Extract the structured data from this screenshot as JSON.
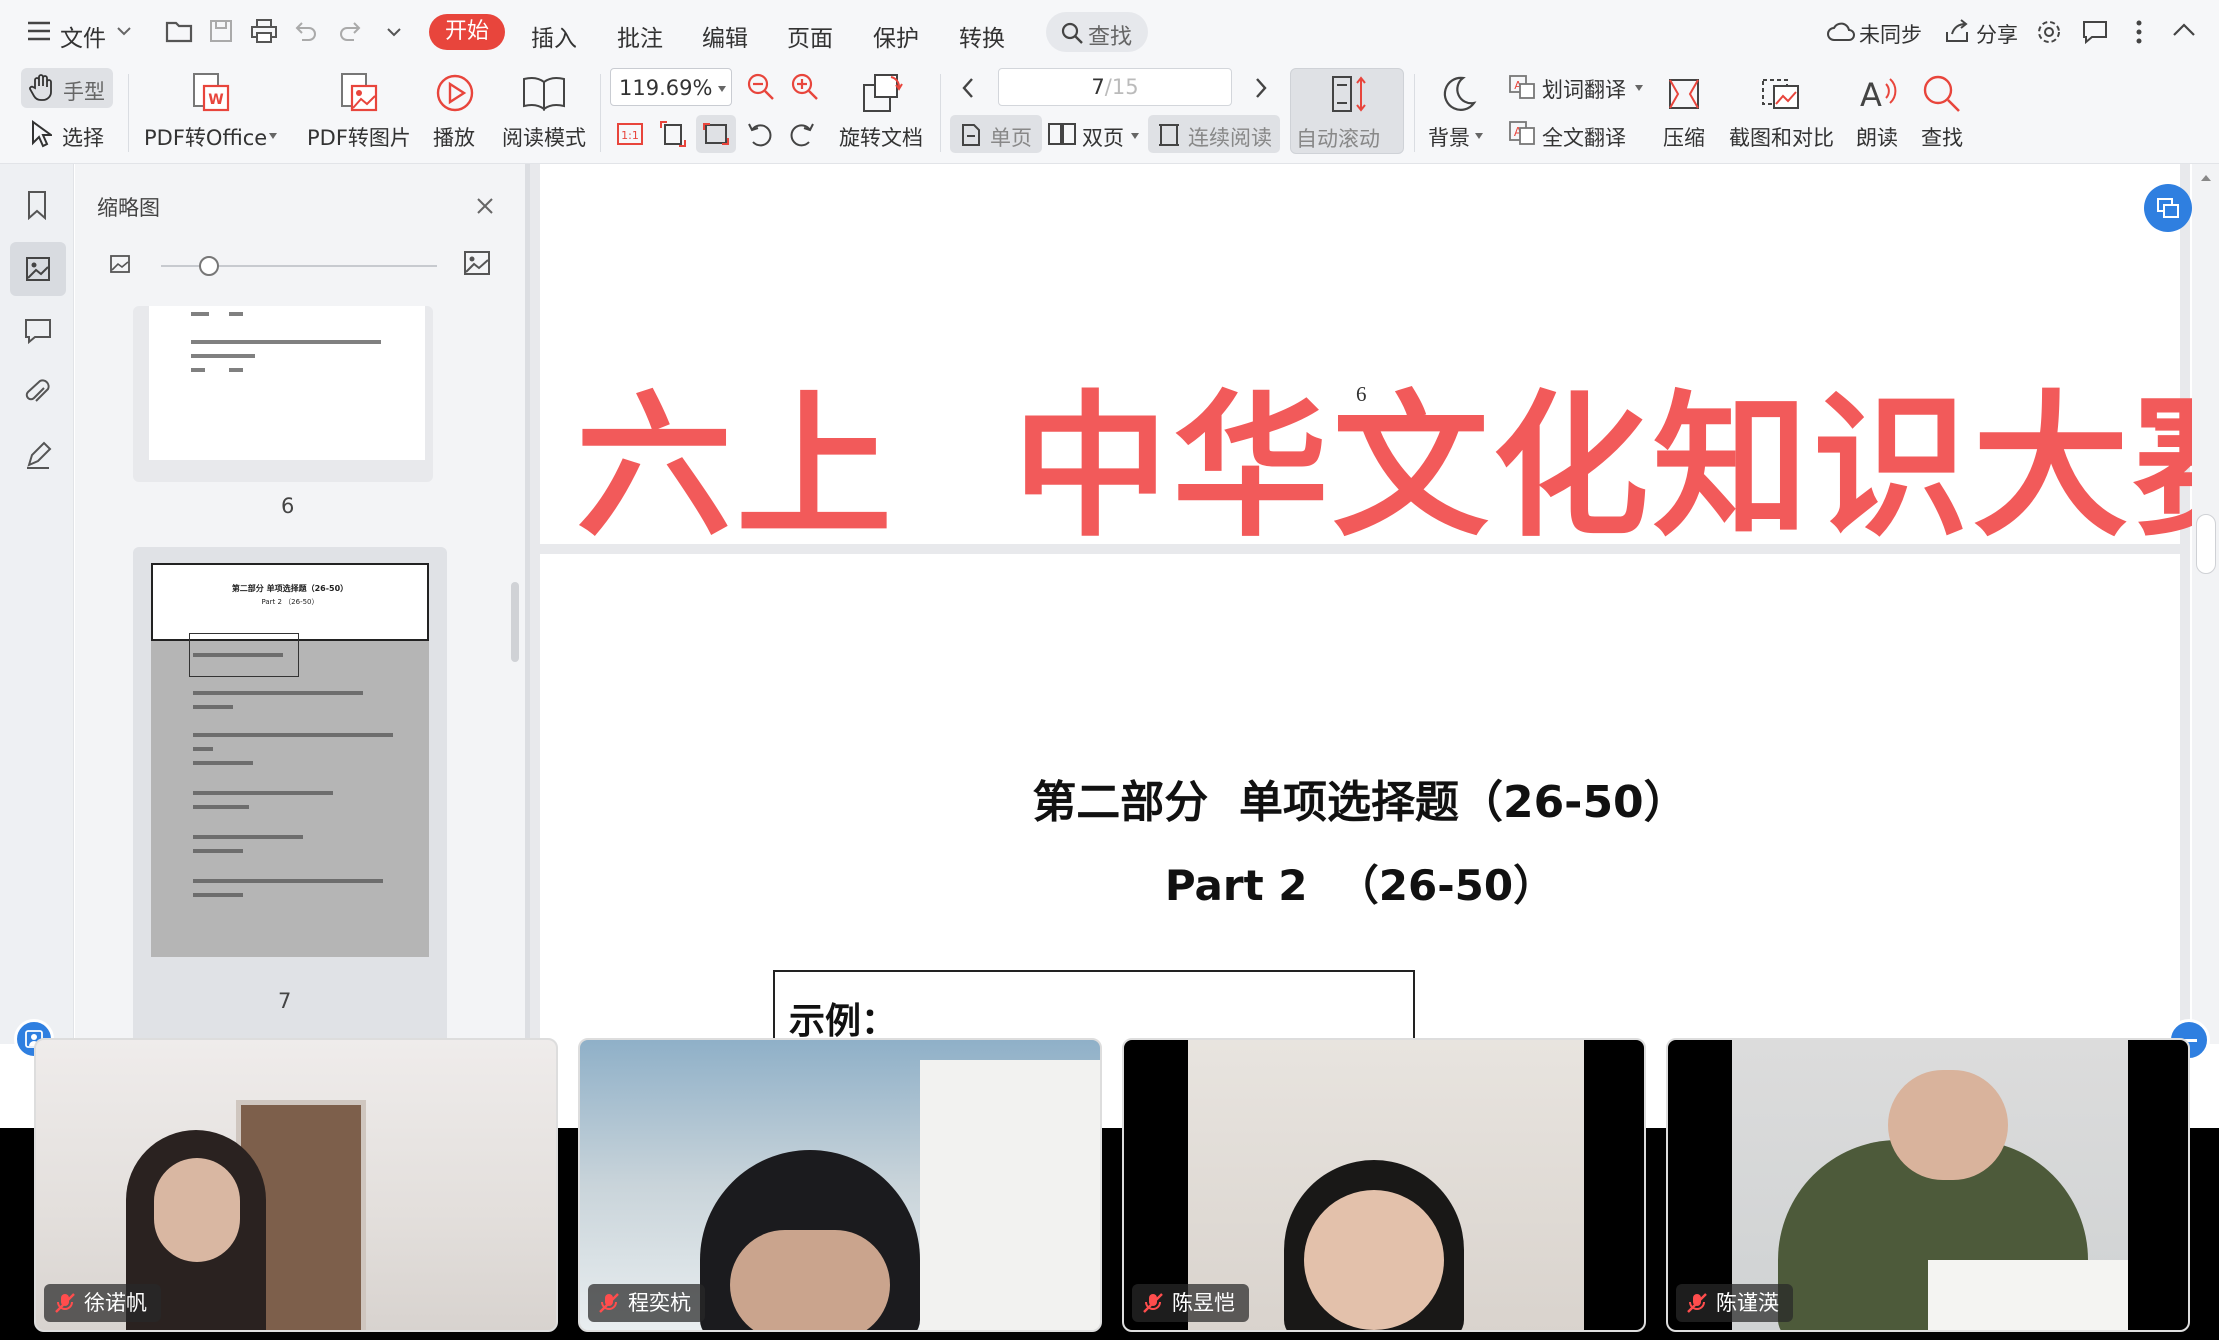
{
  "menubar": {
    "file": "文件",
    "tabs": [
      "开始",
      "插入",
      "批注",
      "编辑",
      "页面",
      "保护",
      "转换"
    ],
    "search": "查找",
    "sync": "未同步",
    "share": "分享"
  },
  "ribbon": {
    "hand_tool": "手型",
    "select_tool": "选择",
    "pdf_to_office": "PDF转Office",
    "pdf_to_image": "PDF转图片",
    "play": "播放",
    "read_mode": "阅读模式",
    "zoom": "119.69%",
    "rotate_doc": "旋转文档",
    "page_current": "7",
    "page_total": "/15",
    "single_page": "单页",
    "double_page": "双页",
    "continuous": "连续阅读",
    "auto_scroll": "自动滚动",
    "background": "背景",
    "word_translate": "划词翻译",
    "full_translate": "全文翻译",
    "compress": "压缩",
    "screenshot_compare": "截图和对比",
    "read_aloud": "朗读",
    "find": "查找"
  },
  "thumbnails": {
    "title": "缩略图",
    "page6_label": "6",
    "page7_label": "7",
    "page7_heading": "第二部分 单项选择题（26-50）",
    "page7_sub": "Part 2 （26-50）"
  },
  "document": {
    "page_number": "6",
    "banner_title": "六上  中华文化知识大赛",
    "section_title": "第二部分  单项选择题（26-50）",
    "section_subtitle": "Part 2  （26-50）",
    "example_label": "示例："
  },
  "participants": [
    {
      "name": "徐诺帆"
    },
    {
      "name": "程奕杭"
    },
    {
      "name": "陈昱恺"
    },
    {
      "name": "陈谨渶"
    }
  ],
  "colors": {
    "accent": "#e8453c",
    "banner_red": "#f25a5a",
    "meeting_blue": "#2f7fe0"
  }
}
